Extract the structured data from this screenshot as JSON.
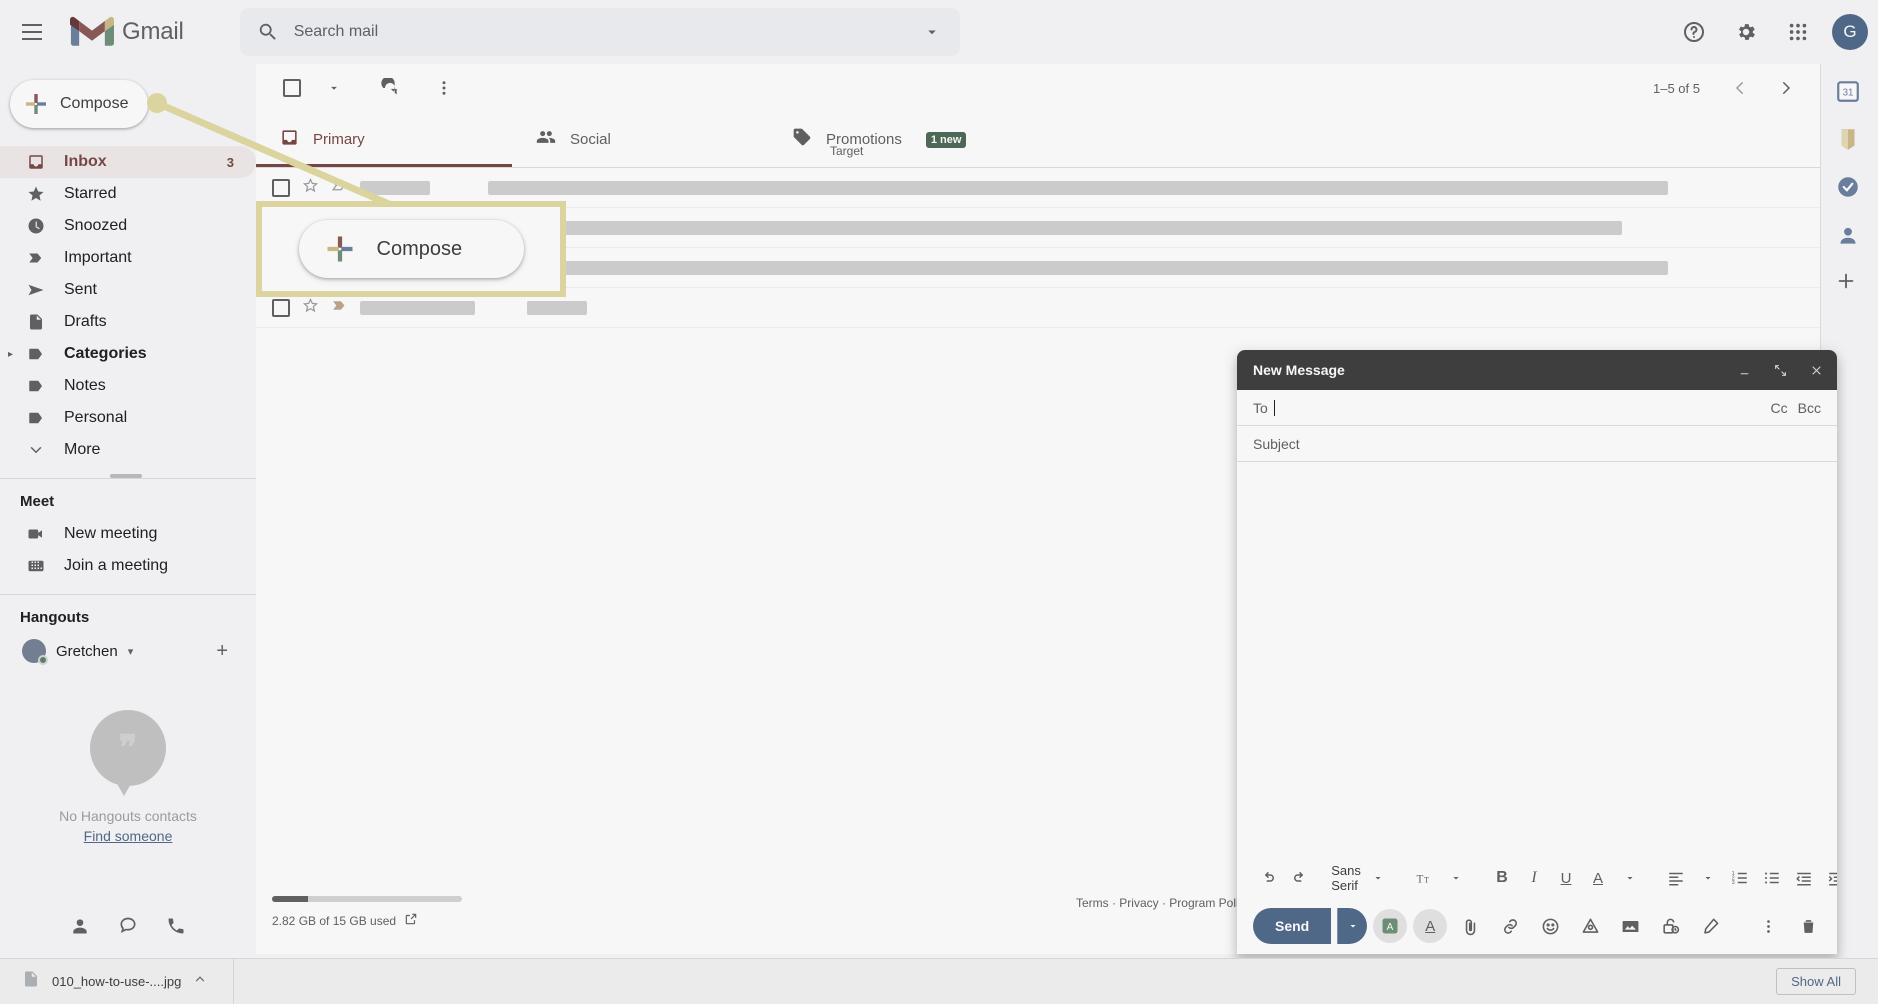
{
  "app": {
    "brand": "Gmail"
  },
  "search": {
    "placeholder": "Search mail",
    "value": ""
  },
  "topbar": {
    "menu_label": "Main menu",
    "help_label": "Support",
    "settings_label": "Settings",
    "apps_label": "Google apps",
    "avatar_letter": "G"
  },
  "compose": {
    "label": "Compose"
  },
  "callout": {
    "label": "Compose"
  },
  "sidebar": {
    "items": [
      {
        "label": "Inbox",
        "icon": "inbox-icon",
        "count": "3",
        "active": true
      },
      {
        "label": "Starred",
        "icon": "star-icon",
        "count": ""
      },
      {
        "label": "Snoozed",
        "icon": "clock-icon",
        "count": ""
      },
      {
        "label": "Important",
        "icon": "important-icon",
        "count": ""
      },
      {
        "label": "Sent",
        "icon": "send-icon",
        "count": ""
      },
      {
        "label": "Drafts",
        "icon": "draft-icon",
        "count": ""
      },
      {
        "label": "Categories",
        "icon": "label-icon",
        "count": "",
        "expandable": true,
        "bold": true
      },
      {
        "label": "Notes",
        "icon": "label-icon",
        "count": ""
      },
      {
        "label": "Personal",
        "icon": "label-icon",
        "count": ""
      },
      {
        "label": "More",
        "icon": "chevron-down-icon",
        "count": ""
      }
    ],
    "meet": {
      "title": "Meet",
      "items": [
        {
          "label": "New meeting",
          "icon": "video-camera-icon"
        },
        {
          "label": "Join a meeting",
          "icon": "keyboard-icon"
        }
      ]
    },
    "hangouts": {
      "title": "Hangouts",
      "user": "Gretchen",
      "empty_text": "No Hangouts contacts",
      "find_link": "Find someone"
    }
  },
  "toolbar": {
    "select_all_label": "Select",
    "refresh_label": "Refresh",
    "more_label": "More",
    "pager_text": "1–5 of 5",
    "prev_label": "Newer",
    "next_label": "Older"
  },
  "tabs": [
    {
      "label": "Primary",
      "icon": "inbox-icon",
      "active": true,
      "badge": "",
      "sub": ""
    },
    {
      "label": "Social",
      "icon": "people-icon",
      "active": false,
      "badge": "",
      "sub": ""
    },
    {
      "label": "Promotions",
      "icon": "tag-icon",
      "active": false,
      "badge": "1 new",
      "sub": "Target"
    }
  ],
  "footer": {
    "storage_text": "2.82 GB of 15 GB used",
    "storage_percent": 19,
    "legal": "Terms · Privacy · Program Policies"
  },
  "compose_window": {
    "title": "New Message",
    "minimize_label": "Minimize",
    "expand_label": "Full screen",
    "close_label": "Save & close",
    "to_label": "To",
    "to_value": "",
    "cc_label": "Cc",
    "bcc_label": "Bcc",
    "subject_placeholder": "Subject",
    "subject_value": "",
    "body_value": "",
    "format": {
      "undo": "undo-icon",
      "redo": "redo-icon",
      "font_name": "Sans Serif",
      "size_label": "Size",
      "bold": "B",
      "italic": "I",
      "underline": "U",
      "text_color": "A",
      "align": "align-icon",
      "numbered_list": "numbered-list-icon",
      "bulleted_list": "bulleted-list-icon",
      "indent_less": "indent-less-icon",
      "indent_more": "indent-more-icon",
      "more": "more-options-icon"
    },
    "send_label": "Send",
    "send_options_label": "More send options",
    "tools": [
      "formatting-options-icon",
      "attach-file-icon",
      "insert-link-icon",
      "insert-emoji-icon",
      "insert-drive-icon",
      "insert-photo-icon",
      "confidential-mode-icon",
      "insert-signature-icon"
    ],
    "more_options_label": "More options",
    "discard_label": "Discard draft"
  },
  "statusbar": {
    "download_file": "010_how-to-use-....jpg",
    "show_all": "Show All"
  }
}
